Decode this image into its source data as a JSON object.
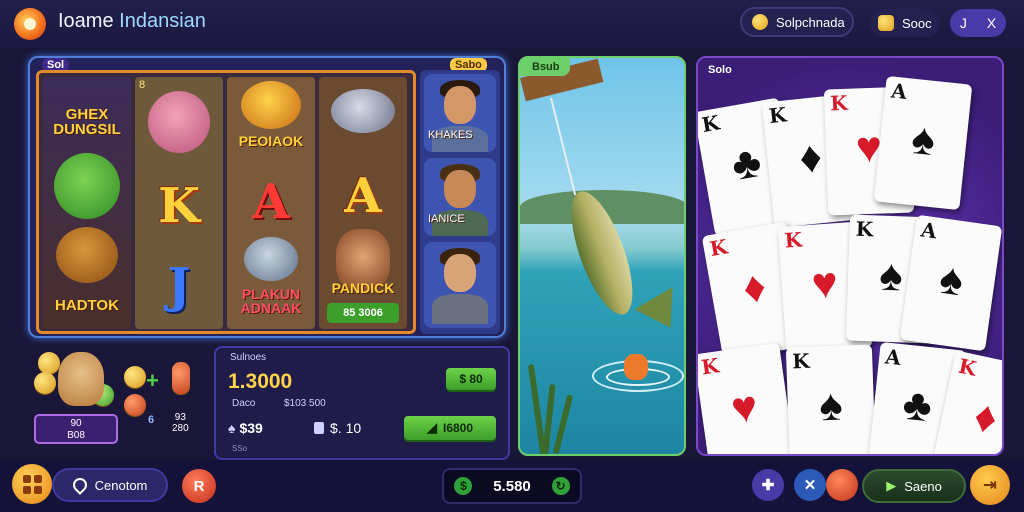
{
  "header": {
    "title_part1": "Ioame ",
    "title_part2": "Indansian",
    "search_label": "Solpchnada",
    "shop_label": "Sooc",
    "circle_icons": [
      "J",
      "X"
    ]
  },
  "slot": {
    "tag_left": "Sol",
    "tag_right": "Sabo",
    "reels": [
      {
        "num": "",
        "symbols": [
          "GHEX\nDUNGSIL",
          "",
          "HADTOK"
        ]
      },
      {
        "num": "8",
        "symbols": [
          "",
          "K",
          "J"
        ]
      },
      {
        "num": "",
        "symbols": [
          "PEOIAOK",
          "A",
          "PLAKUN\nADNAAK"
        ]
      },
      {
        "num": "",
        "symbols": [
          "",
          "A",
          "PANDICK"
        ]
      }
    ],
    "reel4_value": "85 3006",
    "side_labels": [
      "KHAKES",
      "IANICE",
      ""
    ]
  },
  "fishing": {
    "tag": "Bsub"
  },
  "cards": {
    "tag": "Solo",
    "cards": [
      {
        "rank": "K",
        "suit": "♣",
        "color": "black"
      },
      {
        "rank": "K",
        "suit": "♦",
        "color": "black"
      },
      {
        "rank": "K",
        "suit": "♥",
        "color": "red"
      },
      {
        "rank": "A",
        "suit": "♠",
        "color": "black"
      },
      {
        "rank": "K",
        "suit": "♦",
        "color": "red"
      },
      {
        "rank": "K",
        "suit": "♥",
        "color": "red"
      },
      {
        "rank": "K",
        "suit": "♠",
        "color": "black"
      },
      {
        "rank": "A",
        "suit": "♠",
        "color": "black"
      },
      {
        "rank": "K",
        "suit": "♥",
        "color": "red"
      },
      {
        "rank": "K",
        "suit": "♠",
        "color": "black"
      },
      {
        "rank": "A",
        "suit": "♣",
        "color": "black"
      },
      {
        "rank": "K",
        "suit": "♦",
        "color": "red"
      }
    ]
  },
  "balance": {
    "heading": "Sulnoes",
    "amount": "1.3000",
    "label": "Daco",
    "small": "$103 500",
    "plus_label": "$ 80",
    "bet_left": "$39",
    "bet_right": "$. 10",
    "spin_label": "I6800",
    "footnote": "SSo"
  },
  "bonus": {
    "line1": "90",
    "line2": "B08",
    "num1": "6",
    "num2_line1": "93",
    "num2_line2": "280"
  },
  "bottom": {
    "support_label": "Cenotom",
    "r_label": "R",
    "wallet_value": "5.580",
    "sound_label": "Saeno"
  },
  "colors": {
    "accent_gold": "#ffd34a",
    "accent_green": "#6dd249",
    "panel_purple": "#7a48c8"
  }
}
